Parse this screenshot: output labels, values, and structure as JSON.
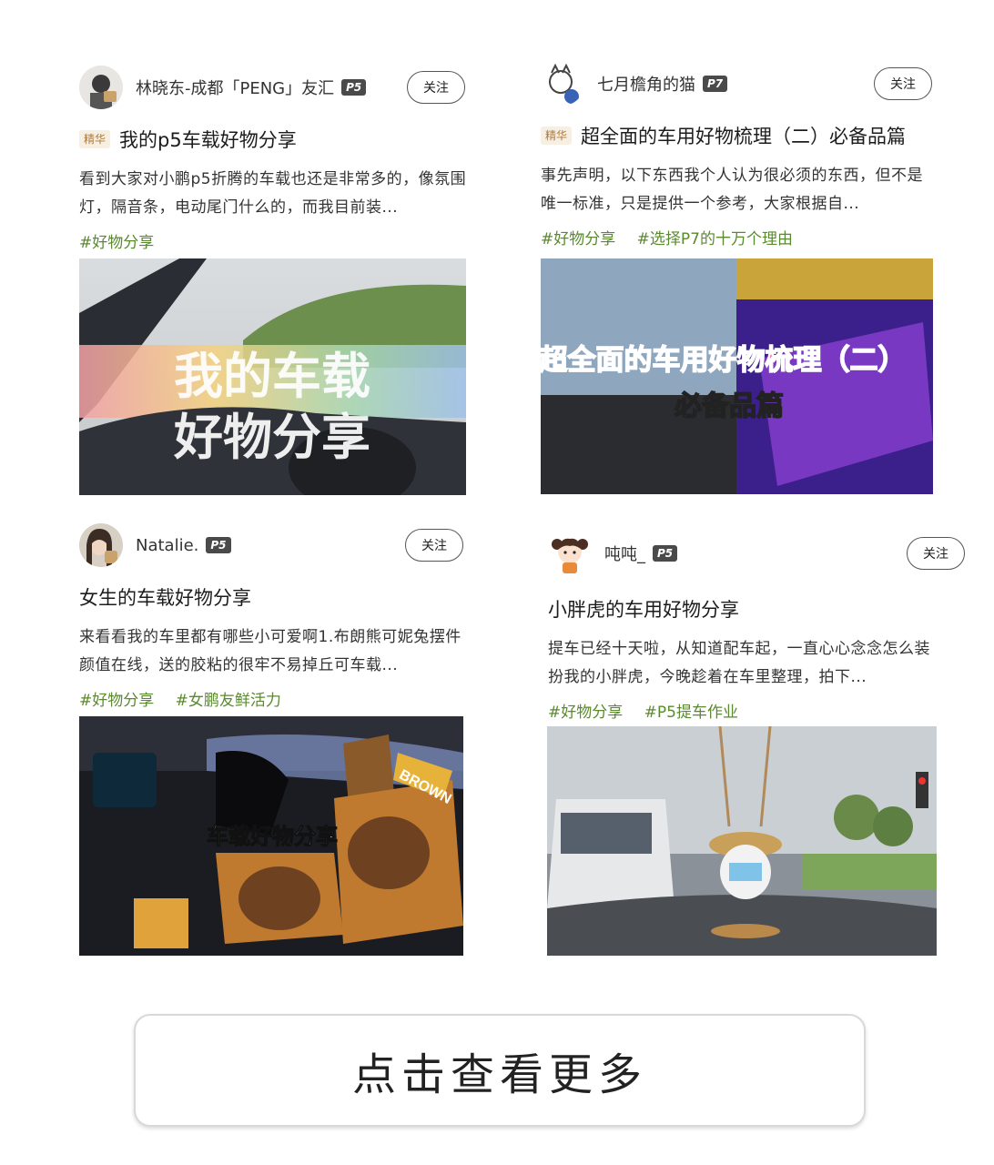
{
  "posts": [
    {
      "username": "林晓东-成都「PENG」友汇",
      "level": "P5",
      "follow_label": "关注",
      "essence_badge": "精华",
      "title": "我的p5车载好物分享",
      "excerpt": "看到大家对小鹏p5折腾的车载也还是非常多的，像氛围灯，隔音条，电动尾门什么的，而我目前装...",
      "tags": [
        "#好物分享"
      ],
      "cover_text": [
        "我的车载",
        "好物分享"
      ]
    },
    {
      "username": "七月檐角的猫",
      "level": "P7",
      "follow_label": "关注",
      "essence_badge": "精华",
      "title": "超全面的车用好物梳理（二）必备品篇",
      "excerpt": "事先声明，以下东西我个人认为很必须的东西，但不是唯一标准，只是提供一个参考，大家根据自...",
      "tags": [
        "#好物分享",
        "#选择P7的十万个理由"
      ],
      "cover_text": [
        "超全面的车用好物梳理（二）",
        "必备品篇"
      ]
    },
    {
      "username": "Natalie.",
      "level": "P5",
      "follow_label": "关注",
      "title": "女生的车载好物分享",
      "excerpt": "来看看我的车里都有哪些小可爱啊1.布朗熊可妮兔摆件颜值在线，送的胶粘的很牢不易掉丘可车载...",
      "tags": [
        "#好物分享",
        "#女鹏友鲜活力"
      ],
      "cover_text": [
        "车载好物分享"
      ],
      "cover_badge": "BROWN"
    },
    {
      "username": "吨吨_",
      "level": "P5",
      "follow_label": "关注",
      "title": "小胖虎的车用好物分享",
      "excerpt": "提车已经十天啦，从知道配车起，一直心心念念怎么装扮我的小胖虎，今晚趁着在车里整理，拍下...",
      "tags": [
        "#好物分享",
        "#P5提车作业"
      ]
    }
  ],
  "load_more_label": "点击查看更多",
  "colors": {
    "tag": "#5a8a2e",
    "essence_bg": "#f6efe2",
    "essence_text": "#b07a3b",
    "level_bg": "#4a4a4a"
  }
}
